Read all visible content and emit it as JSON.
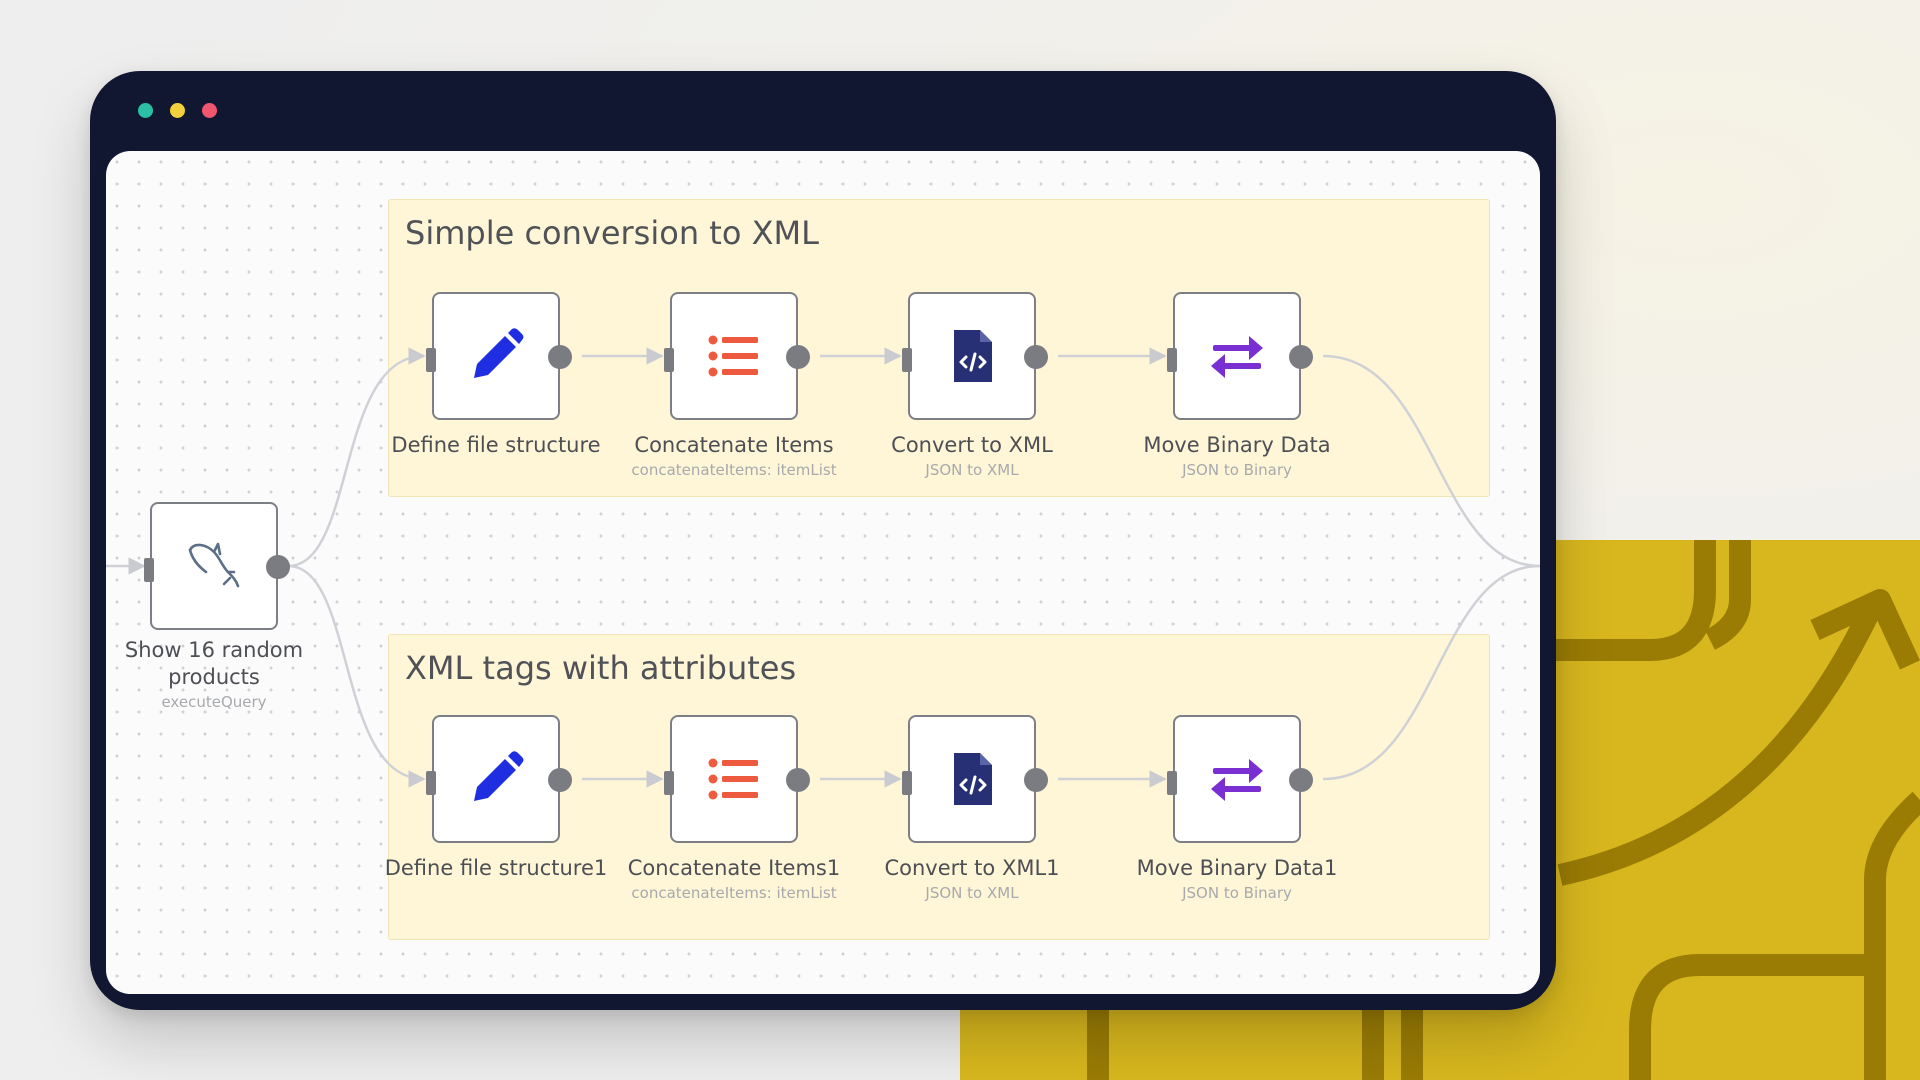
{
  "window": {
    "controls": [
      {
        "name": "teal-dot",
        "color": "#2bbfa5"
      },
      {
        "name": "yellow-dot",
        "color": "#f2d03b"
      },
      {
        "name": "pink-dot",
        "color": "#f0576f"
      }
    ]
  },
  "colors": {
    "accent_yellow": "#d8b71e",
    "node_border": "#7d7f86",
    "sticky_bg": "#fff6d7"
  },
  "groups": [
    {
      "title": "Simple conversion to XML"
    },
    {
      "title": "XML tags with attributes"
    }
  ],
  "trigger_node": {
    "label_line1": "Show 16 random",
    "label_line2": "products",
    "subtitle": "executeQuery",
    "icon": "mysql-dolphin-icon"
  },
  "row1": [
    {
      "label": "Define file structure",
      "subtitle": "",
      "icon": "pencil-icon"
    },
    {
      "label": "Concatenate Items",
      "subtitle": "concatenateItems: itemList",
      "icon": "list-icon"
    },
    {
      "label": "Convert to XML",
      "subtitle": "JSON to XML",
      "icon": "xml-file-icon"
    },
    {
      "label": "Move Binary Data",
      "subtitle": "JSON to Binary",
      "icon": "swap-arrows-icon"
    }
  ],
  "row2": [
    {
      "label": "Define file structure1",
      "subtitle": "",
      "icon": "pencil-icon"
    },
    {
      "label": "Concatenate Items1",
      "subtitle": "concatenateItems: itemList",
      "icon": "list-icon"
    },
    {
      "label": "Convert to XML1",
      "subtitle": "JSON to XML",
      "icon": "xml-file-icon"
    },
    {
      "label": "Move Binary Data1",
      "subtitle": "JSON to Binary",
      "icon": "swap-arrows-icon"
    }
  ]
}
